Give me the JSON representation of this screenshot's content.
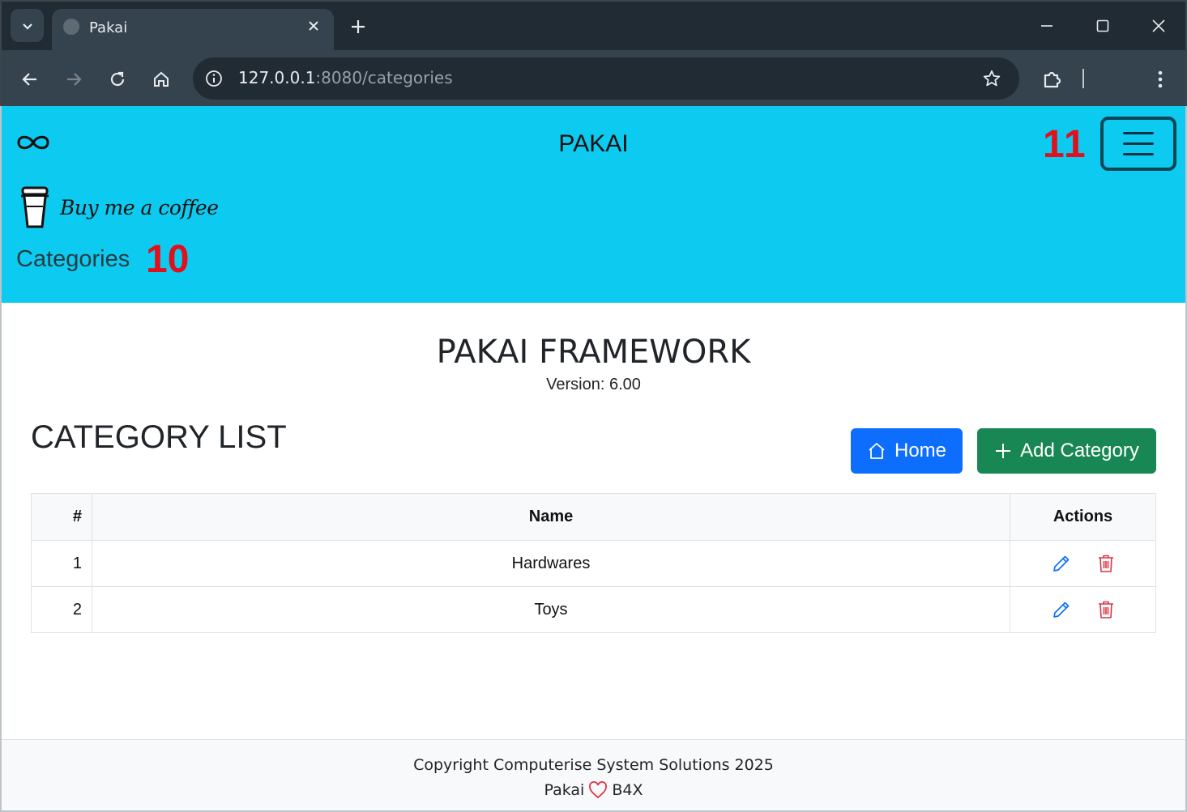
{
  "browser": {
    "tab_title": "Pakai",
    "url_host": "127.0.0.1",
    "url_path": ":8080/categories"
  },
  "header": {
    "brand": "PAKAI",
    "coffee_label": "Buy me a coffee",
    "breadcrumb": "Categories",
    "marker_menu": "11",
    "marker_crumb": "10"
  },
  "main": {
    "framework_title": "PAKAI FRAMEWORK",
    "version": "Version: 6.00",
    "list_title": "CATEGORY LIST",
    "home_label": "Home",
    "add_label": "Add Category"
  },
  "table": {
    "headers": [
      "#",
      "Name",
      "Actions"
    ],
    "rows": [
      {
        "num": "1",
        "name": "Hardwares"
      },
      {
        "num": "2",
        "name": "Toys"
      }
    ]
  },
  "footer": {
    "copyright": "Copyright Computerise System Solutions 2025",
    "left": "Pakai",
    "right": "B4X"
  },
  "colors": {
    "header_bg": "#0dcaf0",
    "primary": "#0d6efd",
    "success": "#198754",
    "danger": "#dc3545",
    "marker": "#e0101c"
  }
}
